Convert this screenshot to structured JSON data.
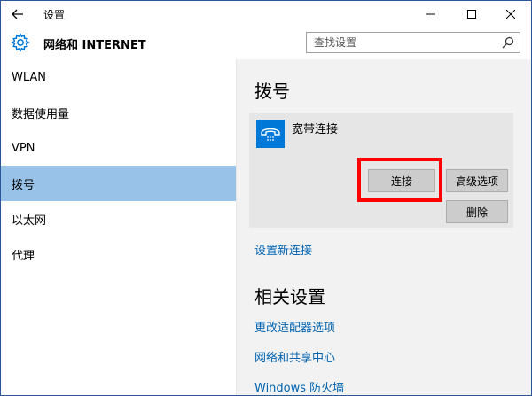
{
  "window": {
    "title": "设置"
  },
  "header": {
    "title": "网络和 INTERNET",
    "search_placeholder": "查找设置"
  },
  "sidebar": {
    "items": [
      {
        "label": "WLAN"
      },
      {
        "label": "数据使用量"
      },
      {
        "label": "VPN"
      },
      {
        "label": "拨号",
        "selected": true
      },
      {
        "label": "以太网"
      },
      {
        "label": "代理"
      }
    ]
  },
  "content": {
    "dialup_title": "拨号",
    "connection": {
      "name": "宽带连接",
      "connect_label": "连接",
      "advanced_label": "高级选项",
      "delete_label": "删除"
    },
    "new_connection_link": "设置新连接",
    "related_title": "相关设置",
    "related_links": [
      "更改适配器选项",
      "网络和共享中心",
      "Windows 防火墙"
    ]
  },
  "colors": {
    "accent": "#0078d7",
    "selected_nav": "#99c2e9",
    "link": "#0063b1",
    "highlight": "#ff0000"
  },
  "icons": {
    "back": "arrow-left-icon",
    "settings": "gear-icon",
    "search": "search-icon",
    "connection": "phone-handset-icon"
  }
}
